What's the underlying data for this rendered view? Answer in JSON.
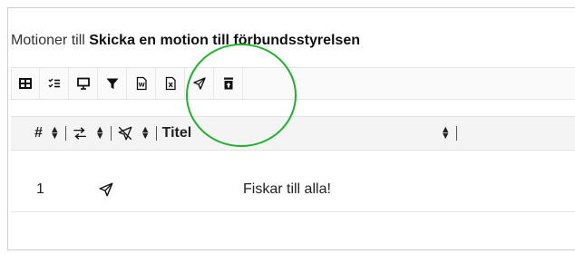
{
  "header": {
    "prefix": "Motioner till ",
    "bold_name": "Skicka en motion till förbundsstyrelsen"
  },
  "toolbar": {
    "buttons": [
      "table-icon",
      "list-checks-icon",
      "presentation-icon",
      "filter-icon",
      "word-export-icon",
      "excel-export-icon",
      "send-icon",
      "archive-icon"
    ]
  },
  "table": {
    "columns": {
      "number": "#",
      "title": "Titel"
    },
    "rows": [
      {
        "number": "1",
        "title": "Fiskar till alla!"
      }
    ]
  },
  "colors": {
    "highlight_circle": "#1db32b"
  }
}
